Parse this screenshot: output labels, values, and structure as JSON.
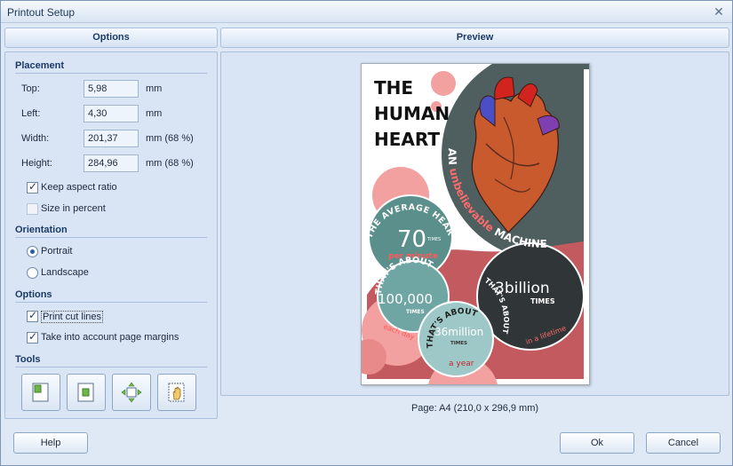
{
  "window": {
    "title": "Printout Setup"
  },
  "headers": {
    "options": "Options",
    "preview": "Preview"
  },
  "placement": {
    "title": "Placement",
    "top": {
      "label": "Top:",
      "value": "5,98",
      "unit": "mm"
    },
    "left": {
      "label": "Left:",
      "value": "4,30",
      "unit": "mm"
    },
    "width": {
      "label": "Width:",
      "value": "201,37",
      "unit": "mm (68 %)"
    },
    "height": {
      "label": "Height:",
      "value": "284,96",
      "unit": "mm (68 %)"
    },
    "keep_aspect": "Keep aspect ratio",
    "size_percent": "Size in percent"
  },
  "orientation": {
    "title": "Orientation",
    "portrait": "Portrait",
    "landscape": "Landscape"
  },
  "options": {
    "title": "Options",
    "print_cut_lines": "Print cut lines",
    "page_margins": "Take into account page margins"
  },
  "tools": {
    "title": "Tools"
  },
  "preview": {
    "page_info": "Page: A4 (210,0 x 296,9 mm)",
    "poster": {
      "title_line1": "THE",
      "title_line2": "HUMAN",
      "title_line3": "HEART",
      "tagline_a": "AN ",
      "tagline_b": "unbelievable",
      "tagline_c": " MACHINE",
      "avg_arc": "THE AVERAGE HEART BEATS",
      "num70": "70",
      "times": "TIMES",
      "per_minute": "per minute",
      "thats_about": "THAT'S ABOUT",
      "num100k": "100,000",
      "each_day": "each day",
      "num3b": "3billion",
      "in_lifetime": "in a lifetime",
      "num36m": "36million",
      "a_year": "a year"
    }
  },
  "buttons": {
    "help": "Help",
    "ok": "Ok",
    "cancel": "Cancel"
  },
  "colors": {
    "accent": "#1b3a66",
    "poster_slate": "#4f5f60",
    "poster_teal": "#5a8f8c",
    "poster_pink": "#e98a8a",
    "poster_red": "#c25a5f",
    "poster_dark": "#303637",
    "poster_light_teal": "#9ec8c8"
  }
}
